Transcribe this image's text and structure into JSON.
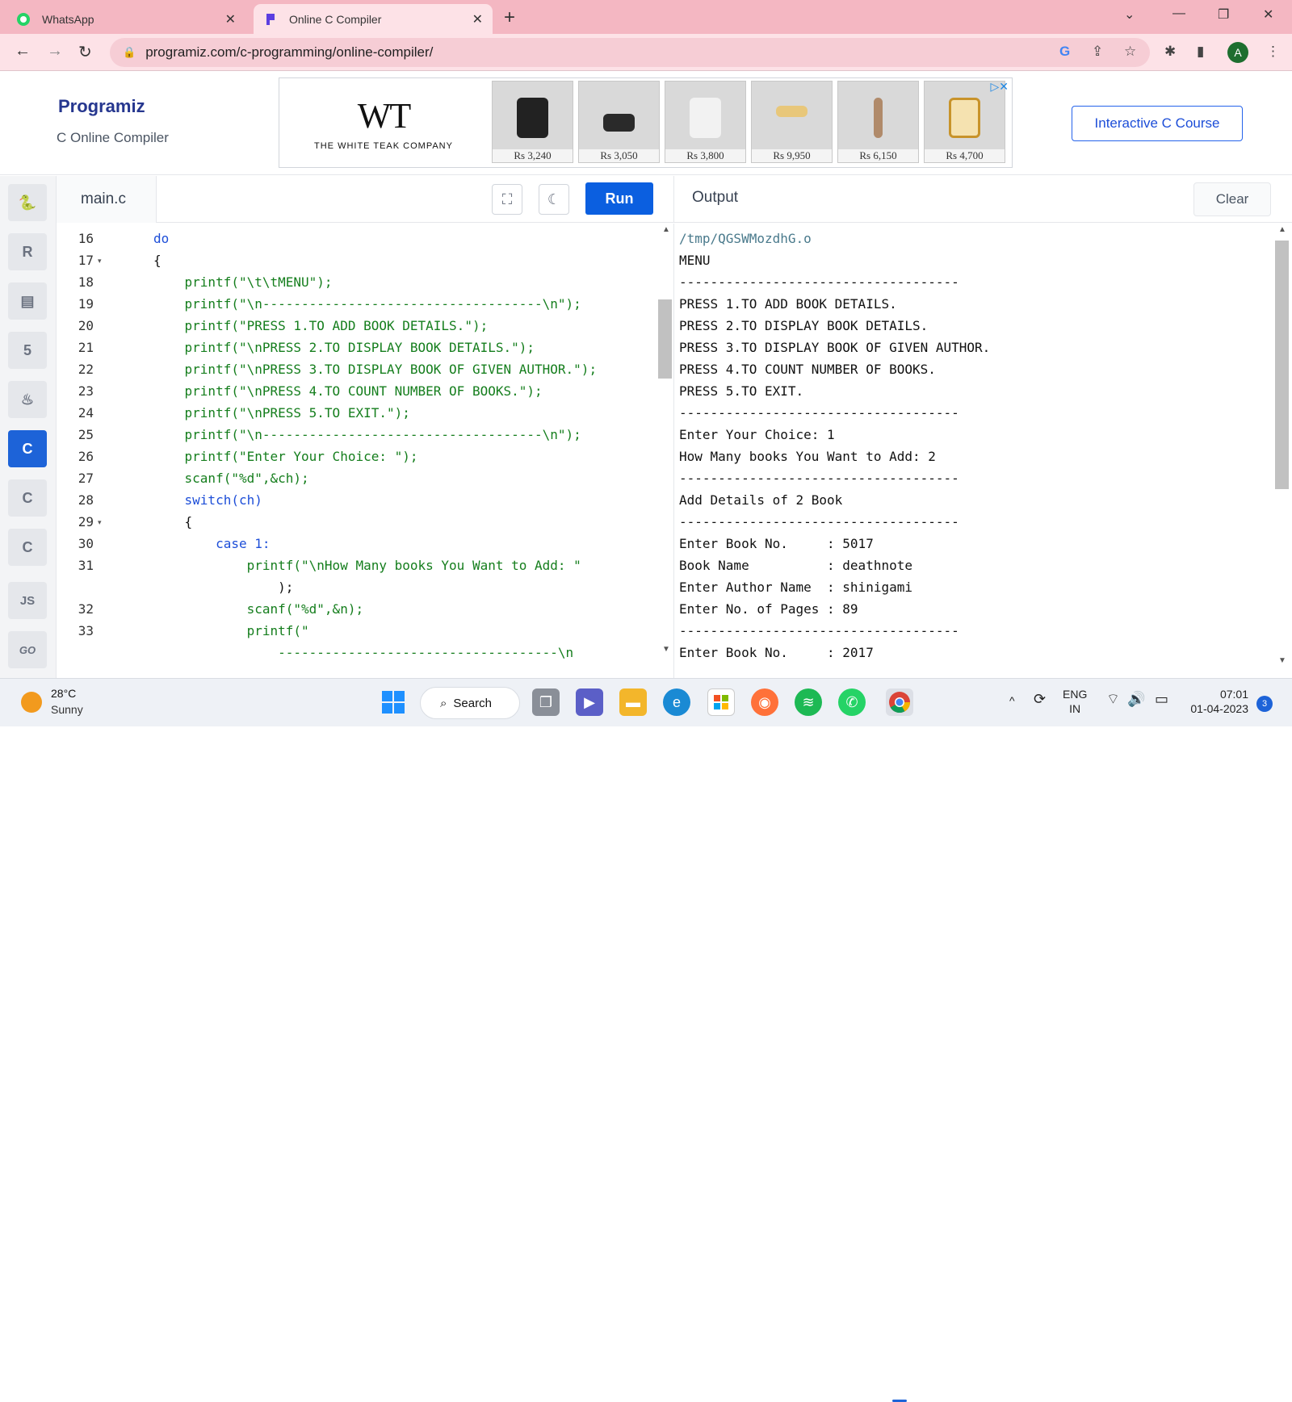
{
  "browser": {
    "tabs": [
      {
        "title": "WhatsApp",
        "active": false
      },
      {
        "title": "Online C Compiler",
        "active": true
      }
    ],
    "url": "programiz.com/c-programming/online-compiler/",
    "profile_initial": "A"
  },
  "site": {
    "logo": "Programiz",
    "subtitle": "C Online Compiler",
    "course_button": "Interactive C Course",
    "ad": {
      "brand_mark": "WT",
      "brand_name": "THE WHITE TEAK COMPANY",
      "prices": [
        "Rs 3,240",
        "Rs 3,050",
        "Rs 3,800",
        "Rs 9,950",
        "Rs 6,150",
        "Rs 4,700"
      ]
    }
  },
  "sidebar": {
    "languages": [
      "python",
      "r",
      "sql",
      "html",
      "java",
      "c",
      "cpp",
      "csharp",
      "js",
      "go"
    ],
    "active": "c",
    "js_label": "JS",
    "go_label": "GO"
  },
  "editor": {
    "filename": "main.c",
    "run_label": "Run",
    "gutter": [
      "16",
      "17",
      "18",
      "19",
      "20",
      "21",
      "22",
      "23",
      "24",
      "25",
      "26",
      "27",
      "28",
      "29",
      "30",
      "31",
      "",
      "32",
      "33",
      ""
    ],
    "lines": [
      "do",
      "{",
      "    printf(\"\\t\\tMENU\");",
      "    printf(\"\\n------------------------------------\\n\");",
      "    printf(\"PRESS 1.TO ADD BOOK DETAILS.\");",
      "    printf(\"\\nPRESS 2.TO DISPLAY BOOK DETAILS.\");",
      "    printf(\"\\nPRESS 3.TO DISPLAY BOOK OF GIVEN AUTHOR.\");",
      "    printf(\"\\nPRESS 4.TO COUNT NUMBER OF BOOKS.\");",
      "    printf(\"\\nPRESS 5.TO EXIT.\");",
      "    printf(\"\\n------------------------------------\\n\");",
      "    printf(\"Enter Your Choice: \");",
      "    scanf(\"%d\",&ch);",
      "    switch(ch)",
      "    {",
      "        case 1:",
      "            printf(\"\\nHow Many books You Want to Add: \"",
      "                );",
      "            scanf(\"%d\",&n);",
      "            printf(\"",
      "                ------------------------------------\\n"
    ]
  },
  "output": {
    "title": "Output",
    "clear_label": "Clear",
    "lines": [
      "/tmp/QGSWMozdhG.o",
      "MENU",
      "------------------------------------",
      "PRESS 1.TO ADD BOOK DETAILS.",
      "PRESS 2.TO DISPLAY BOOK DETAILS.",
      "PRESS 3.TO DISPLAY BOOK OF GIVEN AUTHOR.",
      "PRESS 4.TO COUNT NUMBER OF BOOKS.",
      "PRESS 5.TO EXIT.",
      "------------------------------------",
      "Enter Your Choice: 1",
      "How Many books You Want to Add: 2",
      "------------------------------------",
      "Add Details of 2 Book",
      "------------------------------------",
      "Enter Book No.     : 5017",
      "Book Name          : deathnote",
      "Enter Author Name  : shinigami",
      "Enter No. of Pages : 89",
      "------------------------------------",
      "Enter Book No.     : 2017"
    ]
  },
  "taskbar": {
    "weather_temp": "28°C",
    "weather_desc": "Sunny",
    "search_label": "Search",
    "lang_top": "ENG",
    "lang_bottom": "IN",
    "time": "07:01",
    "date": "01-04-2023",
    "notifications": "3"
  },
  "colors": {
    "tabbar": "#f4b7c2",
    "accent": "#0b5fe0",
    "keyword": "#1d4ed8",
    "string": "#157e1d"
  }
}
